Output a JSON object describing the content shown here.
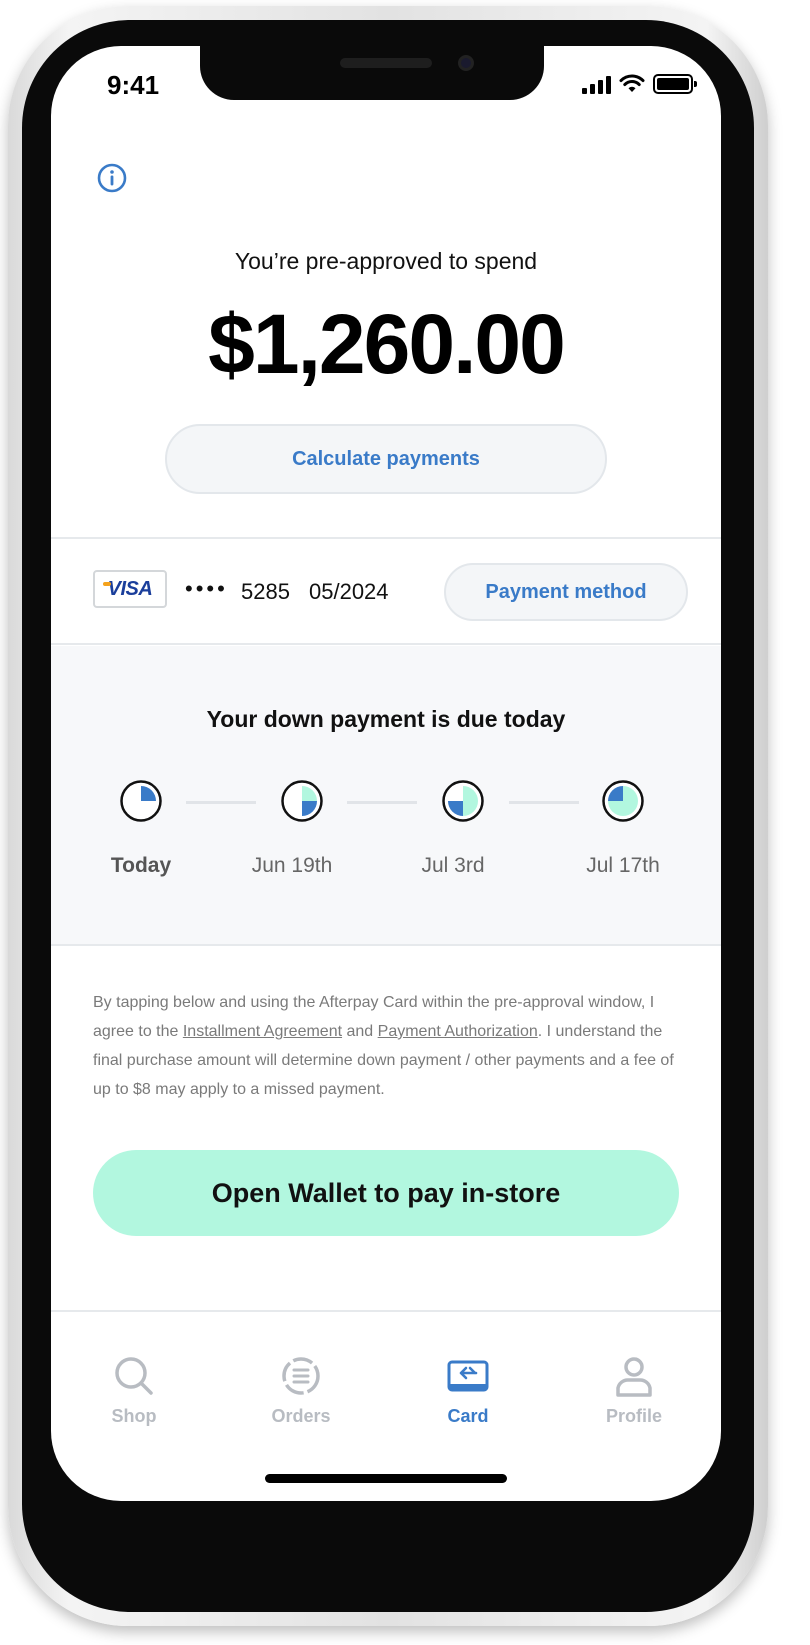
{
  "status_bar": {
    "time": "9:41"
  },
  "header": {
    "info_icon": "info-icon"
  },
  "approval": {
    "title": "You’re pre-approved to spend",
    "amount": "$1,260.00",
    "calculate_label": "Calculate payments"
  },
  "card": {
    "brand": "VISA",
    "dots": "••••",
    "last4": "5285",
    "expiry": "05/2024",
    "payment_method_label": "Payment method"
  },
  "schedule": {
    "title": "Your down payment is due today",
    "installments": [
      {
        "label": "Today",
        "paid_quarters": 1
      },
      {
        "label": "Jun 19th",
        "paid_quarters": 2
      },
      {
        "label": "Jul 3rd",
        "paid_quarters": 3
      },
      {
        "label": "Jul 17th",
        "paid_quarters": 4
      }
    ]
  },
  "disclaimer": {
    "text_1": "By tapping below and using the Afterpay Card within the pre-approval window, I agree to the ",
    "link_1": "Installment Agreement",
    "text_2": " and ",
    "link_2": "Payment Authorization",
    "text_3": ". I understand the final purchase amount will determine down payment / other payments and a fee of up to $8 may apply to a missed payment."
  },
  "wallet_button": {
    "label": "Open Wallet to pay in-store"
  },
  "tabs": [
    {
      "label": "Shop",
      "icon": "search-icon",
      "active": false
    },
    {
      "label": "Orders",
      "icon": "orders-icon",
      "active": false
    },
    {
      "label": "Card",
      "icon": "card-icon",
      "active": true
    },
    {
      "label": "Profile",
      "icon": "profile-icon",
      "active": false
    }
  ],
  "colors": {
    "accent_blue": "#3a7bc8",
    "mint": "#b2f7df",
    "pie_light": "#b2f7df",
    "pie_dark": "#3a7bc8"
  }
}
